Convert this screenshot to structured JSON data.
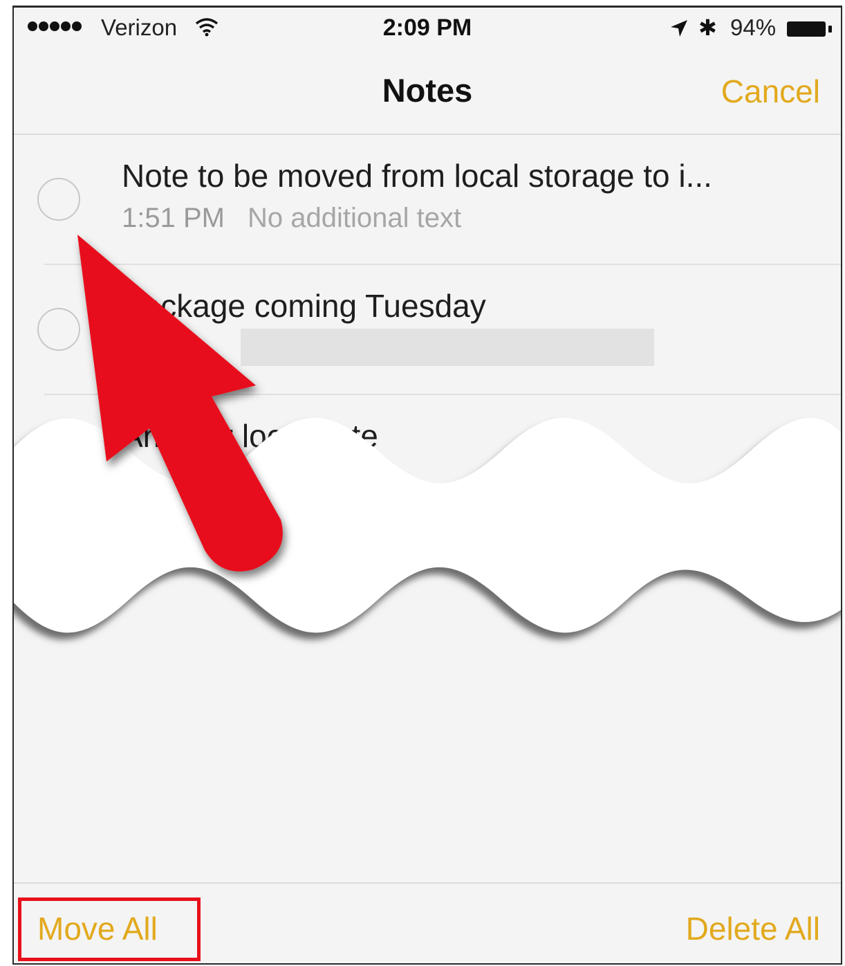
{
  "status_bar": {
    "carrier": "Verizon",
    "time": "2:09 PM",
    "bluetooth_symbol": "✱",
    "battery_percent": "94%"
  },
  "nav": {
    "title": "Notes",
    "cancel_label": "Cancel"
  },
  "notes": [
    {
      "title": "Note to be moved from local storage to i...",
      "time": "1:51 PM",
      "subtitle": "No additional text"
    },
    {
      "title": "Package coming Tuesday",
      "time": "",
      "subtitle": ""
    },
    {
      "title": "Another local note",
      "time": "",
      "subtitle": ""
    }
  ],
  "toolbar": {
    "move_all_label": "Move All",
    "delete_all_label": "Delete All"
  },
  "colors": {
    "accent": "#e2a91d",
    "highlight_box": "#e8101a",
    "arrow": "#e8101a"
  },
  "icons": [
    "signal-dots-icon",
    "wifi-icon",
    "location-arrow-icon",
    "bluetooth-icon",
    "battery-icon",
    "red-pointer-arrow-icon"
  ]
}
